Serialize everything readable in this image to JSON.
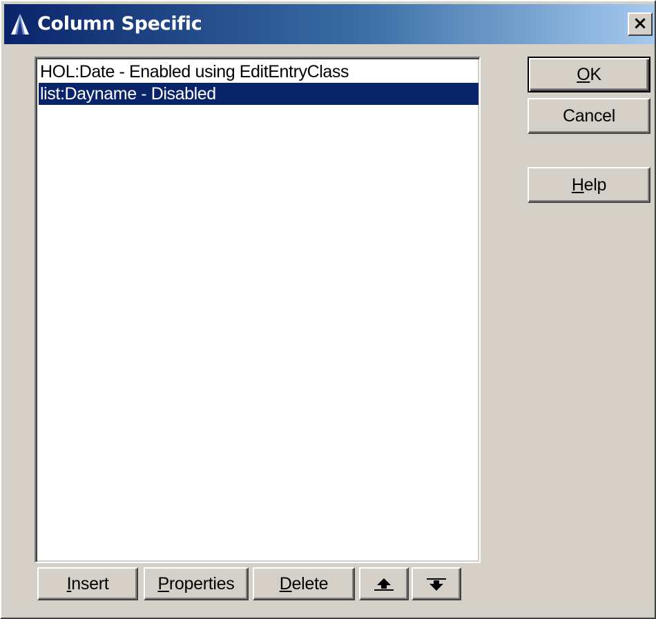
{
  "window": {
    "title": "Column Specific",
    "icon": "app-icon",
    "close_glyph": "×",
    "titlebar_colors": [
      "#0a246a",
      "#a6caf0"
    ]
  },
  "list": {
    "items": [
      {
        "label": "HOL:Date - Enabled using EditEntryClass",
        "selected": false
      },
      {
        "label": "list:Dayname - Disabled",
        "selected": true
      }
    ],
    "selection_color": "#0a246a"
  },
  "buttons": {
    "ok": {
      "mnemonic": "O",
      "rest": "K"
    },
    "cancel": {
      "label": "Cancel"
    },
    "help": {
      "mnemonic": "H",
      "rest": "elp"
    },
    "insert": {
      "mnemonic": "I",
      "rest": "nsert"
    },
    "properties": {
      "mnemonic": "P",
      "rest": "roperties"
    },
    "delete": {
      "mnemonic": "D",
      "rest": "elete"
    },
    "move_up": {
      "icon": "move-up-icon"
    },
    "move_down": {
      "icon": "move-down-icon"
    }
  }
}
